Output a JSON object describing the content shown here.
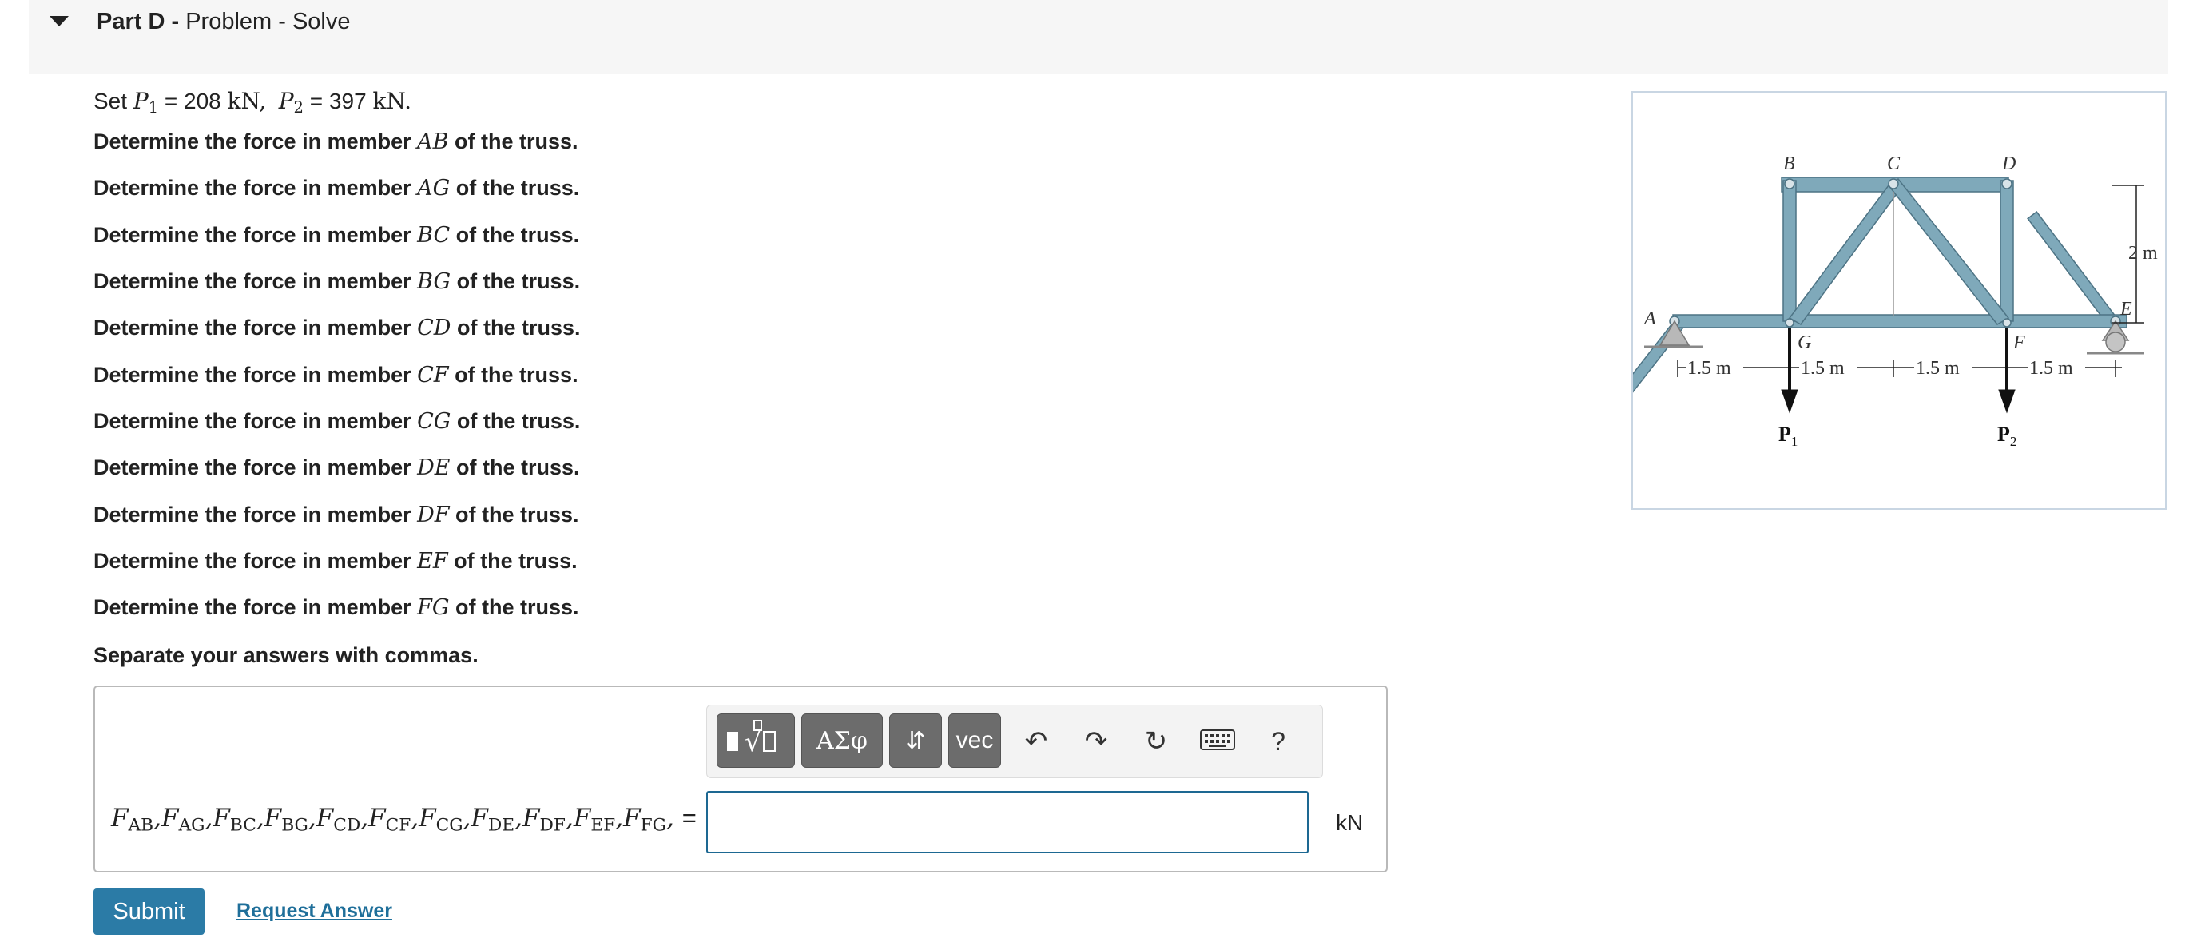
{
  "header": {
    "part_label": "Part D -",
    "part_title": "Problem - Solve"
  },
  "given": {
    "prefix": "Set",
    "p1_symbol": "P",
    "p1_sub": "1",
    "p1_value": "= 208",
    "p2_symbol": "P",
    "p2_sub": "2",
    "p2_value": "= 397",
    "unit": "kN",
    "comma": ",",
    "end": "."
  },
  "questions": [
    {
      "prefix": "Determine the force in member",
      "member": "AB",
      "suffix": "of the truss."
    },
    {
      "prefix": "Determine the force in member",
      "member": "AG",
      "suffix": "of the truss."
    },
    {
      "prefix": "Determine the force in member",
      "member": "BC",
      "suffix": "of the truss."
    },
    {
      "prefix": "Determine the force in member",
      "member": "BG",
      "suffix": "of the truss."
    },
    {
      "prefix": "Determine the force in member",
      "member": "CD",
      "suffix": "of the truss."
    },
    {
      "prefix": "Determine the force in member",
      "member": "CF",
      "suffix": "of the truss."
    },
    {
      "prefix": "Determine the force in member",
      "member": "CG",
      "suffix": "of the truss."
    },
    {
      "prefix": "Determine the force in member",
      "member": "DE",
      "suffix": "of the truss."
    },
    {
      "prefix": "Determine the force in member",
      "member": "DF",
      "suffix": "of the truss."
    },
    {
      "prefix": "Determine the force in member",
      "member": "EF",
      "suffix": "of the truss."
    },
    {
      "prefix": "Determine the force in member",
      "member": "FG",
      "suffix": "of the truss."
    }
  ],
  "separate_note": "Separate your answers with commas.",
  "toolbar": {
    "templates_icon": "templates-icon",
    "greek_label": "ΑΣφ",
    "arrows_icon": "up-down-arrows-icon",
    "vec_label": "vec",
    "undo_icon": "undo-icon",
    "redo_icon": "redo-icon",
    "reset_icon": "reset-icon",
    "keyboard_icon": "keyboard-icon",
    "help_label": "?"
  },
  "answer": {
    "force_symbol": "F",
    "members": [
      "AB",
      "AG",
      "BC",
      "BG",
      "CD",
      "CF",
      "CG",
      "DE",
      "DF",
      "EF",
      "FG"
    ],
    "equals": "=",
    "value": "",
    "unit": "kN"
  },
  "actions": {
    "submit_label": "Submit",
    "request_label": "Request Answer"
  },
  "figure": {
    "joint_labels": {
      "A": "A",
      "B": "B",
      "C": "C",
      "D": "D",
      "E": "E",
      "F": "F",
      "G": "G"
    },
    "spans": [
      "1.5 m",
      "1.5 m",
      "1.5 m",
      "1.5 m"
    ],
    "height": "2 m",
    "load_symbol": "P",
    "load_sub_1": "1",
    "load_sub_2": "2",
    "member_color": "#7fa9ba",
    "member_edge": "#4d7384"
  }
}
